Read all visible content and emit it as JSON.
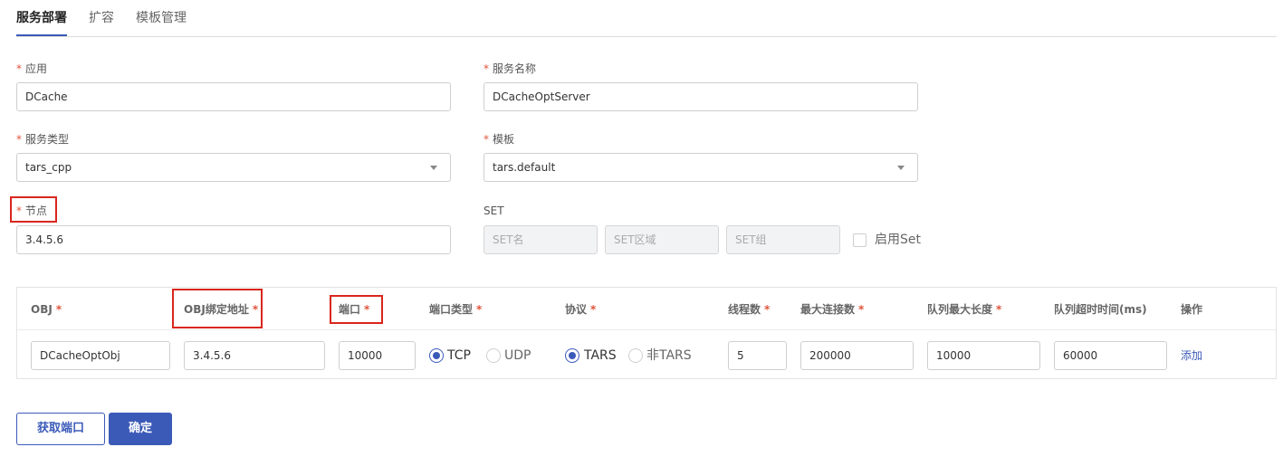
{
  "tabs": [
    {
      "label": "服务部署",
      "active": true
    },
    {
      "label": "扩容",
      "active": false
    },
    {
      "label": "模板管理",
      "active": false
    }
  ],
  "form": {
    "app": {
      "label": "应用",
      "required_mark": "*",
      "value": "DCache"
    },
    "server_name": {
      "label": "服务名称",
      "required_mark": "*",
      "value": "DCacheOptServer"
    },
    "server_type": {
      "label": "服务类型",
      "required_mark": "*",
      "value": "tars_cpp"
    },
    "template": {
      "label": "模板",
      "required_mark": "*",
      "value": "tars.default"
    },
    "node": {
      "label": "节点",
      "required_mark": "*",
      "value": "3.4.5.6"
    },
    "set": {
      "label": "SET",
      "name_placeholder": "SET名",
      "area_placeholder": "SET区域",
      "group_placeholder": "SET组",
      "enable_label": "启用Set",
      "enabled": false
    }
  },
  "table": {
    "required_mark": "*",
    "headers": {
      "obj": "OBJ",
      "bind_addr": "OBJ绑定地址",
      "port": "端口",
      "port_type": "端口类型",
      "protocol": "协议",
      "threads": "线程数",
      "max_conn": "最大连接数",
      "queue_len": "队列最大长度",
      "queue_timeout": "队列超时时间(ms)",
      "action": "操作"
    },
    "row": {
      "obj": "DCacheOptObj",
      "bind_addr": "3.4.5.6",
      "port": "10000",
      "port_type_options": [
        "TCP",
        "UDP"
      ],
      "port_type_selected": "TCP",
      "protocol_options": [
        "TARS",
        "非TARS"
      ],
      "protocol_selected": "TARS",
      "threads": "5",
      "max_conn": "200000",
      "queue_len": "10000",
      "queue_timeout": "60000",
      "add_label": "添加"
    }
  },
  "buttons": {
    "get_port": "获取端口",
    "confirm": "确定"
  },
  "colors": {
    "accent": "#3b5ab8",
    "required": "#e0533b",
    "highlight_box": "#d9261c"
  }
}
